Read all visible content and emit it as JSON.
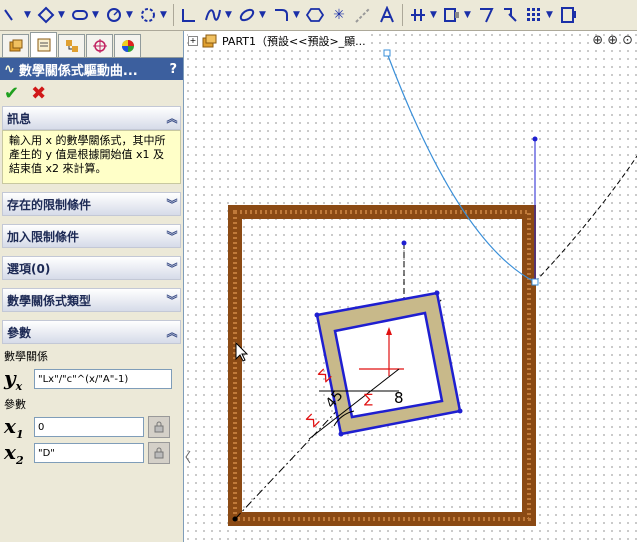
{
  "panel": {
    "title": "數學關係式驅動曲...",
    "help": "?",
    "message_header": "訊息",
    "message_text": "輸入用 x 的數學關係式，其中所產生的 y 值是根據開始值 x1 及結束值 x2 來計算。",
    "sections": [
      "存在的限制條件",
      "加入限制條件",
      "選項(0)",
      "數學關係式類型"
    ],
    "params_header": "參數",
    "eq_label": "數學關係",
    "eq_value": "\"Lx\"/\"c\"^(x/\"A\"-1)",
    "params_label": "參數",
    "x1_value": "0",
    "x2_value": "\"D\""
  },
  "canvas": {
    "tree_label": "PART1（預設<<預設>_顯...",
    "dim_text": "8",
    "dim_text2": "45",
    "sigma": "∑"
  },
  "colors": {
    "frame": "#8b4a14",
    "sketch": "#1f1fd0",
    "curve": "#3a8fd8",
    "fill": "#c8b98a"
  }
}
